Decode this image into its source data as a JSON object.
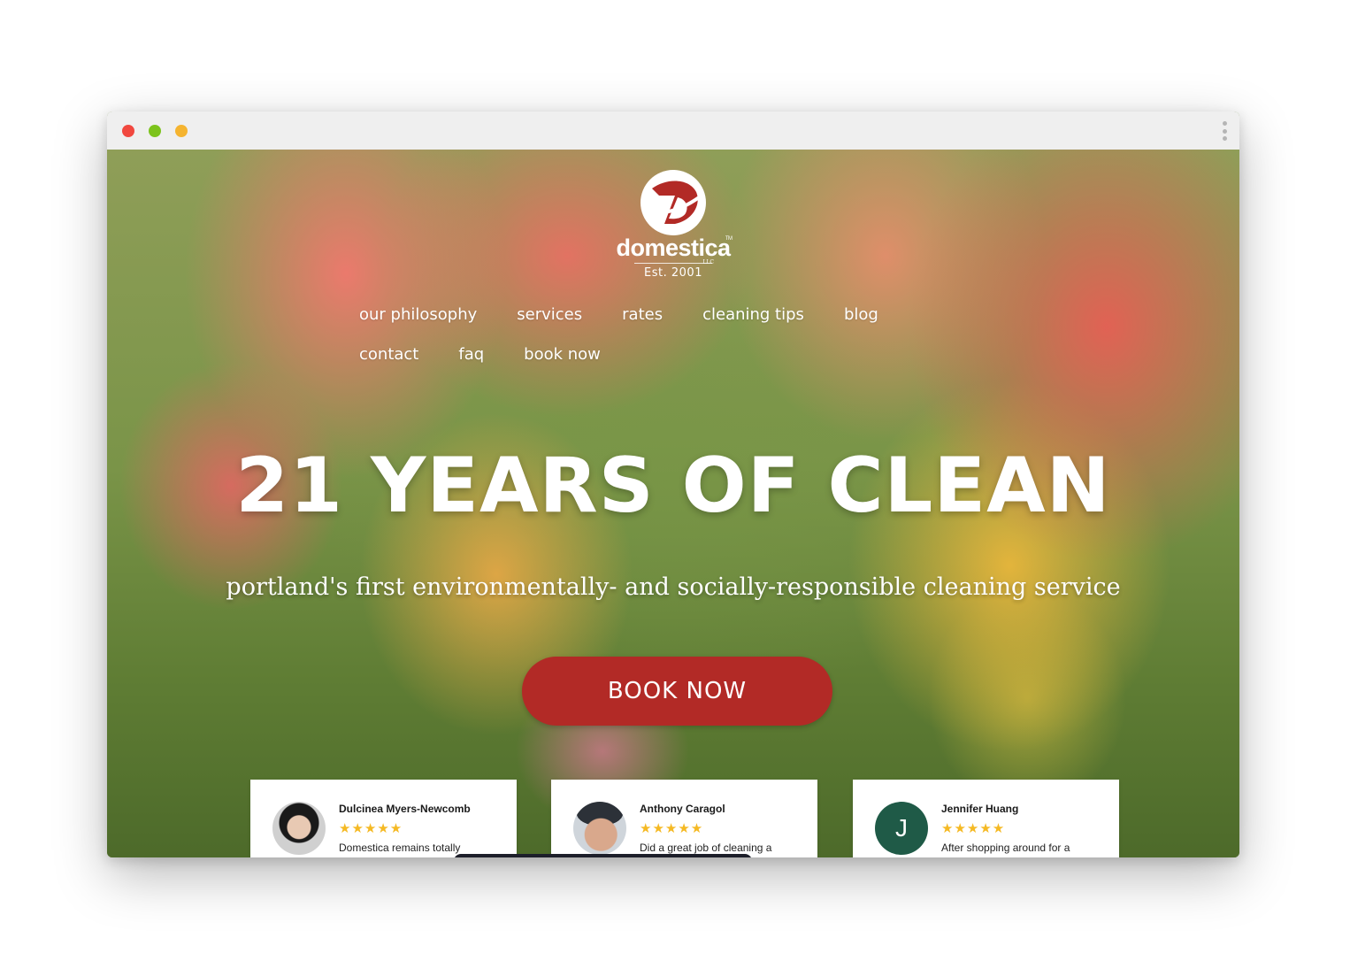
{
  "brand": {
    "name": "domestica",
    "trademark": "TM",
    "suffix": "LLC",
    "established": "Est. 2001"
  },
  "nav": {
    "items": [
      {
        "label": "our philosophy"
      },
      {
        "label": "services"
      },
      {
        "label": "rates"
      },
      {
        "label": "cleaning tips"
      },
      {
        "label": "blog"
      },
      {
        "label": "contact"
      },
      {
        "label": "faq"
      },
      {
        "label": "book now"
      }
    ]
  },
  "hero": {
    "headline": "21 YEARS OF CLEAN",
    "subheadline": "portland's first environmentally- and socially-responsible cleaning service",
    "cta_label": "BOOK NOW"
  },
  "reviews": [
    {
      "name": "Dulcinea Myers-Newcomb",
      "rating": 5,
      "stars": "★★★★★",
      "excerpt": "Domestica remains totally"
    },
    {
      "name": "Anthony Caragol",
      "rating": 5,
      "stars": "★★★★★",
      "excerpt": "Did a great job of cleaning a"
    },
    {
      "name": "Jennifer Huang",
      "rating": 5,
      "stars": "★★★★★",
      "excerpt": "After shopping around for a",
      "initial": "J"
    }
  ],
  "colors": {
    "accent_red": "#b22a26",
    "star_gold": "#f5b923",
    "avatar_green": "#1f5a47",
    "window_close": "#f1483f",
    "window_minimize": "#7cc31c",
    "window_zoom": "#f5b430"
  },
  "icons": {
    "window_controls": [
      "close-dot",
      "minimize-dot",
      "zoom-dot"
    ],
    "menu": "kebab-menu-icon",
    "logo": "domestica-d-logo-icon",
    "star": "star-icon"
  }
}
